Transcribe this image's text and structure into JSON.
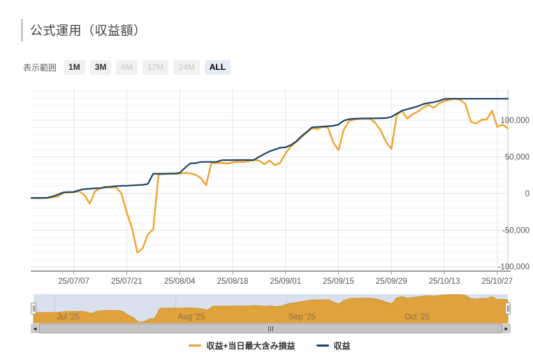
{
  "header": {
    "title": "公式運用（収益額）"
  },
  "range_selector": {
    "label": "表示範囲",
    "buttons": [
      {
        "label": "1M",
        "state": "enabled"
      },
      {
        "label": "3M",
        "state": "enabled"
      },
      {
        "label": "6M",
        "state": "disabled"
      },
      {
        "label": "12M",
        "state": "disabled"
      },
      {
        "label": "24M",
        "state": "disabled"
      },
      {
        "label": "ALL",
        "state": "selected"
      }
    ]
  },
  "legend": {
    "items": [
      {
        "label": "収益+当日最大含み損益",
        "color": "#F0A32F"
      },
      {
        "label": "収益",
        "color": "#1D4466"
      }
    ]
  },
  "colors": {
    "series_unrealized": "#F0A32F",
    "series_profit": "#1D4466",
    "navigator_fill": "#DFA23D",
    "navigator_bg": "#DAE1EE",
    "selected_button_bg": "#E6EBF5",
    "axis_line": "#9E9E9E",
    "grid_major": "#E4E4E4",
    "grid_minor": "#F3F3F3"
  },
  "chart_data": {
    "type": "line",
    "grid": true,
    "legend_position": "bottom",
    "ylim": [
      -106000,
      142000
    ],
    "y_ticks": [
      {
        "value": 100000,
        "label": "100,000"
      },
      {
        "value": 50000,
        "label": "50,000"
      },
      {
        "value": 0,
        "label": "0"
      },
      {
        "value": -50000,
        "label": "-50,000"
      },
      {
        "value": -100000,
        "label": "-100,000"
      }
    ],
    "x_ticks": [
      {
        "index": 8,
        "label": "25/07/07"
      },
      {
        "index": 18,
        "label": "25/07/21"
      },
      {
        "index": 28,
        "label": "25/08/04"
      },
      {
        "index": 38,
        "label": "25/08/18"
      },
      {
        "index": 48,
        "label": "25/09/01"
      },
      {
        "index": 58,
        "label": "25/09/15"
      },
      {
        "index": 68,
        "label": "25/09/29"
      },
      {
        "index": 78,
        "label": "25/10/13"
      },
      {
        "index": 88,
        "label": "25/10/27"
      }
    ],
    "x_dates": [
      "25/06/25",
      "25/06/26",
      "25/06/27",
      "25/06/30",
      "25/07/01",
      "25/07/02",
      "25/07/03",
      "25/07/04",
      "25/07/07",
      "25/07/08",
      "25/07/09",
      "25/07/10",
      "25/07/11",
      "25/07/14",
      "25/07/15",
      "25/07/16",
      "25/07/17",
      "25/07/18",
      "25/07/21",
      "25/07/22",
      "25/07/23",
      "25/07/24",
      "25/07/25",
      "25/07/28",
      "25/07/29",
      "25/07/30",
      "25/07/31",
      "25/08/01",
      "25/08/04",
      "25/08/05",
      "25/08/06",
      "25/08/07",
      "25/08/08",
      "25/08/11",
      "25/08/12",
      "25/08/13",
      "25/08/14",
      "25/08/15",
      "25/08/18",
      "25/08/19",
      "25/08/20",
      "25/08/21",
      "25/08/22",
      "25/08/25",
      "25/08/26",
      "25/08/27",
      "25/08/28",
      "25/08/29",
      "25/09/01",
      "25/09/02",
      "25/09/03",
      "25/09/04",
      "25/09/05",
      "25/09/08",
      "25/09/09",
      "25/09/10",
      "25/09/11",
      "25/09/12",
      "25/09/15",
      "25/09/16",
      "25/09/17",
      "25/09/18",
      "25/09/19",
      "25/09/22",
      "25/09/23",
      "25/09/24",
      "25/09/25",
      "25/09/26",
      "25/09/29",
      "25/09/30",
      "25/10/01",
      "25/10/02",
      "25/10/03",
      "25/10/06",
      "25/10/07",
      "25/10/08",
      "25/10/09",
      "25/10/10",
      "25/10/13",
      "25/10/14",
      "25/10/15",
      "25/10/16",
      "25/10/17",
      "25/10/20",
      "25/10/21",
      "25/10/22",
      "25/10/23",
      "25/10/24",
      "25/10/27",
      "25/10/28",
      "25/10/29"
    ],
    "series": [
      {
        "name": "収益+当日最大含み損益",
        "color": "#F0A32F",
        "values": [
          -6000,
          -6500,
          -6200,
          -6000,
          -5500,
          -4000,
          500,
          1500,
          1800,
          3000,
          -2000,
          -14000,
          3000,
          7000,
          9500,
          8000,
          8500,
          300,
          -26000,
          -47000,
          -80600,
          -75000,
          -56000,
          -49000,
          25500,
          26500,
          27000,
          26800,
          27200,
          28000,
          27400,
          25700,
          21000,
          11400,
          41700,
          41500,
          41800,
          41000,
          42500,
          43200,
          42800,
          44000,
          45500,
          45000,
          40000,
          44800,
          38400,
          42000,
          55000,
          64000,
          70000,
          77000,
          83000,
          89000,
          88000,
          91000,
          90000,
          70000,
          59000,
          87000,
          99000,
          101000,
          102000,
          102300,
          102000,
          96000,
          86000,
          70000,
          61000,
          107000,
          113000,
          102000,
          108000,
          112000,
          117000,
          121000,
          117000,
          123000,
          126000,
          128000,
          129300,
          128000,
          122000,
          98000,
          95500,
          100500,
          101000,
          113000,
          91000,
          94000,
          89000
        ]
      },
      {
        "name": "収益",
        "color": "#1D4466",
        "values": [
          -6000,
          -6000,
          -6000,
          -5800,
          -4000,
          -1500,
          1500,
          1900,
          2100,
          4500,
          6000,
          6500,
          7000,
          7300,
          8500,
          9200,
          10000,
          10500,
          10600,
          11000,
          11500,
          11800,
          13000,
          27000,
          27000,
          27000,
          27200,
          27300,
          28000,
          35000,
          41000,
          41500,
          43000,
          43100,
          43100,
          43200,
          45500,
          45600,
          45600,
          45700,
          45700,
          45700,
          45800,
          50000,
          54000,
          57500,
          60000,
          62500,
          63000,
          66000,
          71000,
          78000,
          84000,
          90200,
          90800,
          91300,
          91800,
          92400,
          94000,
          99400,
          101500,
          102000,
          102300,
          102400,
          102500,
          102600,
          102800,
          103000,
          104500,
          109000,
          113000,
          115000,
          117000,
          119000,
          122000,
          123500,
          124500,
          126500,
          129000,
          129300,
          129300,
          129300,
          129300,
          129300,
          129300,
          129300,
          129300,
          129300,
          129300,
          129300,
          129300
        ]
      }
    ],
    "navigator": {
      "month_ticks": [
        {
          "index": 4,
          "label": "Jul '25"
        },
        {
          "index": 27,
          "label": "Aug '25"
        },
        {
          "index": 48,
          "label": "Sep '25"
        },
        {
          "index": 70,
          "label": "Oct '25"
        }
      ]
    }
  }
}
